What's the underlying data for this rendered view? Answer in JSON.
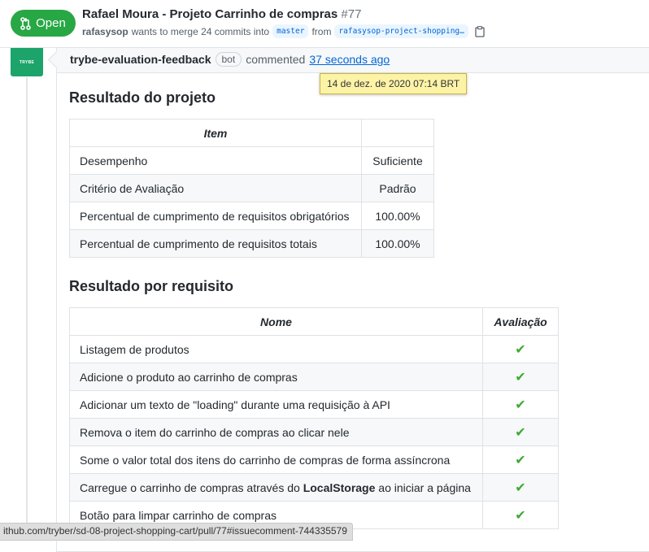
{
  "pr": {
    "state_label": "Open",
    "title": "Rafael Moura - Projeto Carrinho de compras",
    "number": "#77",
    "author": "rafasysop",
    "merge_text": "wants to merge 24 commits into",
    "base_branch": "master",
    "from_text": "from",
    "head_branch": "rafasysop-project-shopping…"
  },
  "comment": {
    "avatar_text": "TRYBE",
    "author": "trybe-evaluation-feedback",
    "bot_label": "bot",
    "action": "commented",
    "time": "37 seconds ago",
    "tooltip": "14 de dez. de 2020 07:14 BRT"
  },
  "project_result": {
    "heading": "Resultado do projeto",
    "columns": [
      "Item",
      ""
    ],
    "rows": [
      [
        "Desempenho",
        "Suficiente"
      ],
      [
        "Critério de Avaliação",
        "Padrão"
      ],
      [
        "Percentual de cumprimento de requisitos obrigatórios",
        "100.00%"
      ],
      [
        "Percentual de cumprimento de requisitos totais",
        "100.00%"
      ]
    ]
  },
  "requirements_result": {
    "heading": "Resultado por requisito",
    "columns": [
      "Nome",
      "Avaliação"
    ],
    "rows": [
      {
        "name": "Listagem de produtos",
        "result": "✔"
      },
      {
        "name": "Adicione o produto ao carrinho de compras",
        "result": "✔"
      },
      {
        "name": "Adicionar um texto de \"loading\" durante uma requisição à API",
        "result": "✔"
      },
      {
        "name": "Remova o item do carrinho de compras ao clicar nele",
        "result": "✔"
      },
      {
        "name": "Some o valor total dos itens do carrinho de compras de forma assíncrona",
        "result": "✔"
      },
      {
        "name_before": "Carregue o carrinho de compras através do ",
        "name_bold": "LocalStorage",
        "name_after": " ao iniciar a página",
        "result": "✔"
      },
      {
        "name": "Botão para limpar carrinho de compras",
        "result": "✔"
      }
    ]
  },
  "status_bar": {
    "url": "ithub.com/tryber/sd-08-project-shopping-cart/pull/77#issuecomment-744335579"
  },
  "colors": {
    "open_green": "#28a745",
    "link_blue": "#0366d6",
    "check_green": "#3fa934",
    "tooltip_yellow": "#fdf3a7"
  }
}
